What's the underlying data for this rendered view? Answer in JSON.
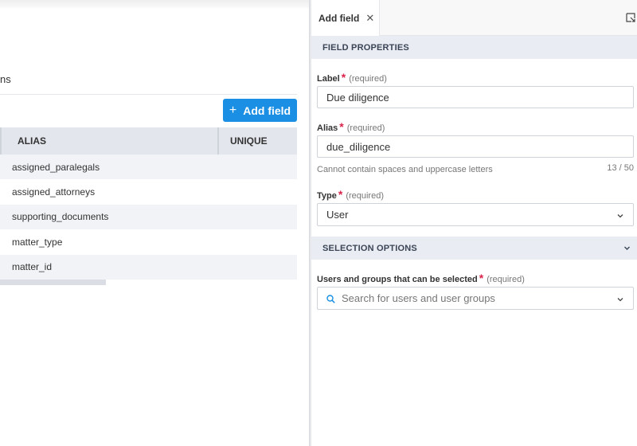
{
  "left": {
    "tab_truncated": "ns",
    "add_field_button": "Add field",
    "add_field_icon": "plus-icon",
    "table": {
      "columns": [
        "ALIAS",
        "UNIQUE"
      ],
      "rows": [
        {
          "alias": "assigned_paralegals"
        },
        {
          "alias": "assigned_attorneys"
        },
        {
          "alias": "supporting_documents"
        },
        {
          "alias": "matter_type"
        },
        {
          "alias": "matter_id"
        }
      ]
    }
  },
  "panel": {
    "tab_title": "Add field",
    "tab_close_icon": "close-icon",
    "expand_icon": "expand-icon",
    "field_properties_header": "FIELD PROPERTIES",
    "label_field": {
      "label": "Label",
      "required_text": "(required)",
      "value": "Due diligence"
    },
    "alias_field": {
      "label": "Alias",
      "required_text": "(required)",
      "value": "due_diligence",
      "hint": "Cannot contain spaces and uppercase letters",
      "counter": "13 / 50"
    },
    "type_field": {
      "label": "Type",
      "required_text": "(required)",
      "value": "User"
    },
    "selection_options_header": "SELECTION OPTIONS",
    "users_field": {
      "label": "Users and groups that can be selected",
      "required_text": "(required)",
      "placeholder": "Search for users and user groups"
    }
  },
  "colors": {
    "primary": "#1a8fe3",
    "required_star": "#d9234b",
    "header_bg": "#e9ecf2",
    "search_icon": "#1a8fe3"
  }
}
